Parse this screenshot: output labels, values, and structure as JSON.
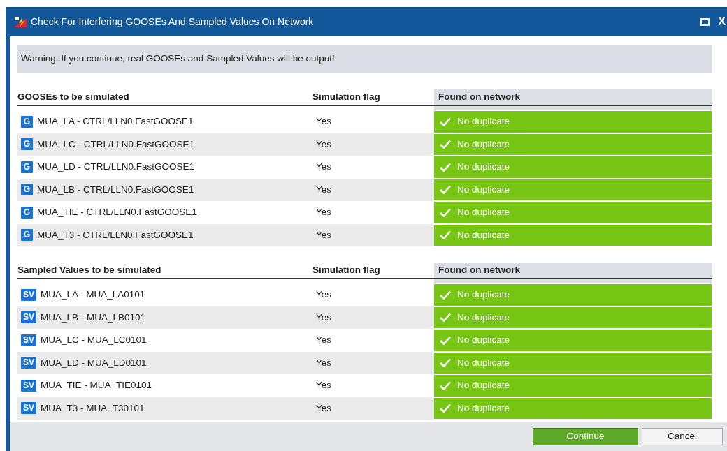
{
  "window": {
    "title": "Check For Interfering GOOSEs And Sampled Values On Network",
    "close": "X"
  },
  "warning": "Warning: If you continue, real GOOSEs and Sampled Values will be output!",
  "sections": [
    {
      "columns": [
        "GOOSEs to be simulated",
        "Simulation flag",
        "Found on network"
      ],
      "rows": [
        {
          "tag": "G",
          "name": "MUA_LA - CTRL/LLN0.FastGOOSE1",
          "flag": "Yes",
          "duplicate": false,
          "result": "No duplicate"
        },
        {
          "tag": "G",
          "name": "MUA_LC - CTRL/LLN0.FastGOOSE1",
          "flag": "Yes",
          "duplicate": false,
          "result": "No duplicate"
        },
        {
          "tag": "G",
          "name": "MUA_LD - CTRL/LLN0.FastGOOSE1",
          "flag": "Yes",
          "duplicate": false,
          "result": "No duplicate"
        },
        {
          "tag": "G",
          "name": "MUA_LB - CTRL/LLN0.FastGOOSE1",
          "flag": "Yes",
          "duplicate": false,
          "result": "No duplicate"
        },
        {
          "tag": "G",
          "name": "MUA_TIE - CTRL/LLN0.FastGOOSE1",
          "flag": "Yes",
          "duplicate": false,
          "result": "No duplicate"
        },
        {
          "tag": "G",
          "name": "MUA_T3 - CTRL/LLN0.FastGOOSE1",
          "flag": "Yes",
          "duplicate": false,
          "result": "No duplicate"
        }
      ]
    },
    {
      "columns": [
        "Sampled Values to be simulated",
        "Simulation flag",
        "Found on network"
      ],
      "rows": [
        {
          "tag": "SV",
          "name": "MUA_LA - MUA_LA0101",
          "flag": "Yes",
          "duplicate": false,
          "result": "No duplicate"
        },
        {
          "tag": "SV",
          "name": "MUA_LB - MUA_LB0101",
          "flag": "Yes",
          "duplicate": false,
          "result": "No duplicate"
        },
        {
          "tag": "SV",
          "name": "MUA_LC - MUA_LC0101",
          "flag": "Yes",
          "duplicate": false,
          "result": "No duplicate"
        },
        {
          "tag": "SV",
          "name": "MUA_LD - MUA_LD0101",
          "flag": "Yes",
          "duplicate": false,
          "result": "No duplicate"
        },
        {
          "tag": "SV",
          "name": "MUA_TIE - MUA_TIE0101",
          "flag": "Yes",
          "duplicate": false,
          "result": "No duplicate"
        },
        {
          "tag": "SV",
          "name": "MUA_T3 - MUA_T30101",
          "flag": "Yes",
          "duplicate": false,
          "result": "No duplicate"
        }
      ]
    }
  ],
  "buttons": [
    {
      "label": "Continue",
      "primary": true
    },
    {
      "label": "Cancel",
      "primary": false
    }
  ]
}
